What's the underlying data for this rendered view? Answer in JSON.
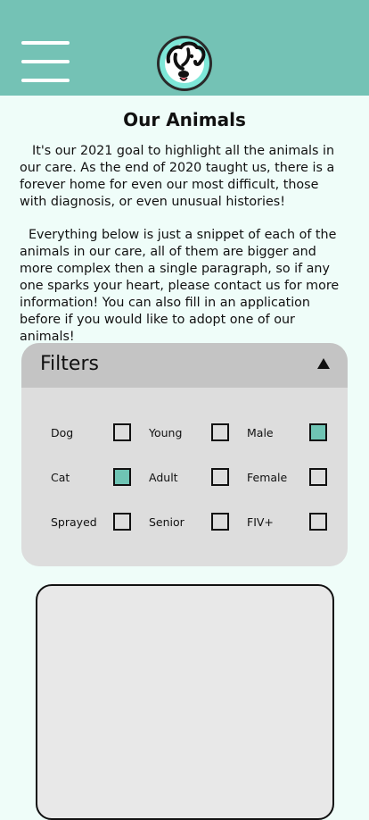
{
  "header": {
    "menu_icon": "hamburger-menu-icon",
    "logo_icon": "dog-logo-icon",
    "colors": {
      "bar": "#74c2b5",
      "logo_ring": "#7ee7d8"
    }
  },
  "page": {
    "title": "Our Animals",
    "intro_paragraph": "It's our 2021 goal to highlight all the animals in our care. As the end of 2020 taught us, there is a forever home for even our most difficult, those with diagnosis, or even unusual histories!",
    "second_paragraph": "Everything below is just a snippet of each of the animals in our care, all of them are bigger and more complex then a single paragraph, so if any one sparks your heart, please contact us for more information! You can also fill in an application before if you would like to adopt one of our animals!"
  },
  "filters": {
    "title": "Filters",
    "toggle_icon": "collapse-triangle-icon",
    "accent_color": "#6fc4b4",
    "options": {
      "dog": {
        "label": "Dog",
        "checked": false
      },
      "young": {
        "label": "Young",
        "checked": false
      },
      "male": {
        "label": "Male",
        "checked": true
      },
      "cat": {
        "label": "Cat",
        "checked": true
      },
      "adult": {
        "label": "Adult",
        "checked": false
      },
      "female": {
        "label": "Female",
        "checked": false
      },
      "sprayed": {
        "label": "Sprayed",
        "checked": false
      },
      "senior": {
        "label": "Senior",
        "checked": false
      },
      "fiv": {
        "label": "FIV+",
        "checked": false
      }
    }
  }
}
